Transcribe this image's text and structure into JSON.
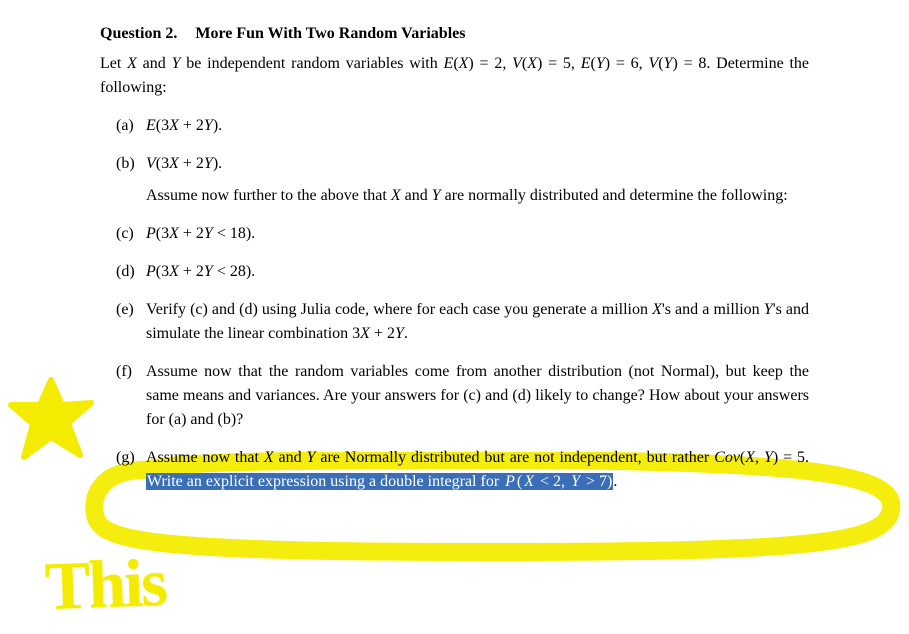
{
  "annotation_colors": {
    "highlighter": "#f4ec00",
    "selection_bg": "#3a6fb7",
    "selection_fg": "#ffffff"
  },
  "header": {
    "number_label": "Question  2.",
    "title": "More Fun With Two Random Variables"
  },
  "intro_plain": "Let X and Y be independent random variables with E(X) = 2, V(X) = 5, E(Y) = 6, V(Y) = 8. Determine the following:",
  "intro_segments": [
    {
      "t": "Let "
    },
    {
      "t": "X",
      "i": true
    },
    {
      "t": " and "
    },
    {
      "t": "Y",
      "i": true
    },
    {
      "t": " be independent random variables with "
    },
    {
      "t": "E",
      "i": true
    },
    {
      "t": "("
    },
    {
      "t": "X",
      "i": true
    },
    {
      "t": ") = 2, "
    },
    {
      "t": "V",
      "i": true
    },
    {
      "t": "("
    },
    {
      "t": "X",
      "i": true
    },
    {
      "t": ") = 5, "
    },
    {
      "t": "E",
      "i": true
    },
    {
      "t": "("
    },
    {
      "t": "Y",
      "i": true
    },
    {
      "t": ") = 6, "
    },
    {
      "t": "V",
      "i": true
    },
    {
      "t": "("
    },
    {
      "t": "Y",
      "i": true
    },
    {
      "t": ") = 8. Determine the following:"
    }
  ],
  "items": [
    {
      "marker": "(a)",
      "segments": [
        {
          "t": "E",
          "i": true
        },
        {
          "t": "(3"
        },
        {
          "t": "X",
          "i": true
        },
        {
          "t": " + 2"
        },
        {
          "t": "Y",
          "i": true
        },
        {
          "t": ")."
        }
      ]
    },
    {
      "marker": "(b)",
      "segments": [
        {
          "t": "V",
          "i": true
        },
        {
          "t": "(3"
        },
        {
          "t": "X",
          "i": true
        },
        {
          "t": " + 2"
        },
        {
          "t": "Y",
          "i": true
        },
        {
          "t": ")."
        }
      ],
      "subnote_segments": [
        {
          "t": "Assume now further to the above that "
        },
        {
          "t": "X",
          "i": true
        },
        {
          "t": " and "
        },
        {
          "t": "Y",
          "i": true
        },
        {
          "t": " are normally distributed and determine the following:"
        }
      ]
    },
    {
      "marker": "(c)",
      "segments": [
        {
          "t": "P",
          "i": true
        },
        {
          "t": "(3"
        },
        {
          "t": "X",
          "i": true
        },
        {
          "t": " + 2"
        },
        {
          "t": "Y",
          "i": true
        },
        {
          "t": " < 18)."
        }
      ]
    },
    {
      "marker": "(d)",
      "segments": [
        {
          "t": "P",
          "i": true
        },
        {
          "t": "(3"
        },
        {
          "t": "X",
          "i": true
        },
        {
          "t": " + 2"
        },
        {
          "t": "Y",
          "i": true
        },
        {
          "t": " < 28)."
        }
      ]
    },
    {
      "marker": "(e)",
      "segments": [
        {
          "t": "Verify (c) and (d) using Julia code, where for each case you generate a million "
        },
        {
          "t": "X",
          "i": true
        },
        {
          "t": "'s and a million "
        },
        {
          "t": "Y",
          "i": true
        },
        {
          "t": "'s and simulate the linear combination 3"
        },
        {
          "t": "X",
          "i": true
        },
        {
          "t": " + 2"
        },
        {
          "t": "Y",
          "i": true
        },
        {
          "t": "."
        }
      ]
    },
    {
      "marker": "(f)",
      "segments": [
        {
          "t": "Assume now that the random variables come from another distribution (not Normal), but keep the same means and variances. Are your answers for (c) and (d) likely to change? How about your answers for (a) and (b)?"
        }
      ]
    },
    {
      "marker": "(g)",
      "segments": [
        {
          "t": "Assume now that "
        },
        {
          "t": "X",
          "i": true
        },
        {
          "t": " and "
        },
        {
          "t": "Y",
          "i": true
        },
        {
          "t": " are Normally distributed but are not independent, but rather "
        },
        {
          "t": "Cov",
          "i": true
        },
        {
          "t": "("
        },
        {
          "t": "X",
          "i": true
        },
        {
          "t": ", "
        },
        {
          "t": "Y",
          "i": true
        },
        {
          "t": ") = 5. "
        },
        {
          "t": "Write an explicit expression using a double integral for ",
          "sel": true
        },
        {
          "t": "P",
          "i": true,
          "sel": true
        },
        {
          "t": "(",
          "sel": true
        },
        {
          "t": "X",
          "i": true,
          "sel": true
        },
        {
          "t": " < 2, ",
          "sel": true
        },
        {
          "t": "Y",
          "i": true,
          "sel": true
        },
        {
          "t": " > 7)",
          "sel": true
        },
        {
          "t": "."
        }
      ]
    }
  ],
  "handwritten_text": "This"
}
